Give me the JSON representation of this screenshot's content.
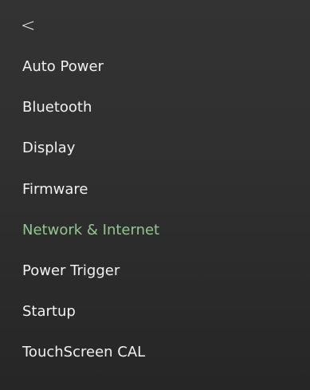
{
  "header": {
    "back_label": "<"
  },
  "menu": {
    "items": [
      {
        "label": "Auto Power",
        "active": false
      },
      {
        "label": "Bluetooth",
        "active": false
      },
      {
        "label": "Display",
        "active": false
      },
      {
        "label": "Firmware",
        "active": false
      },
      {
        "label": "Network & Internet",
        "active": true
      },
      {
        "label": "Power Trigger",
        "active": false
      },
      {
        "label": "Startup",
        "active": false
      },
      {
        "label": "TouchScreen CAL",
        "active": false
      }
    ]
  },
  "colors": {
    "background_top": "#333333",
    "background_bottom": "#262626",
    "text": "#f1f1f1",
    "active_text": "#92c78c"
  },
  "icons": {
    "back": "chevron-left-icon"
  }
}
